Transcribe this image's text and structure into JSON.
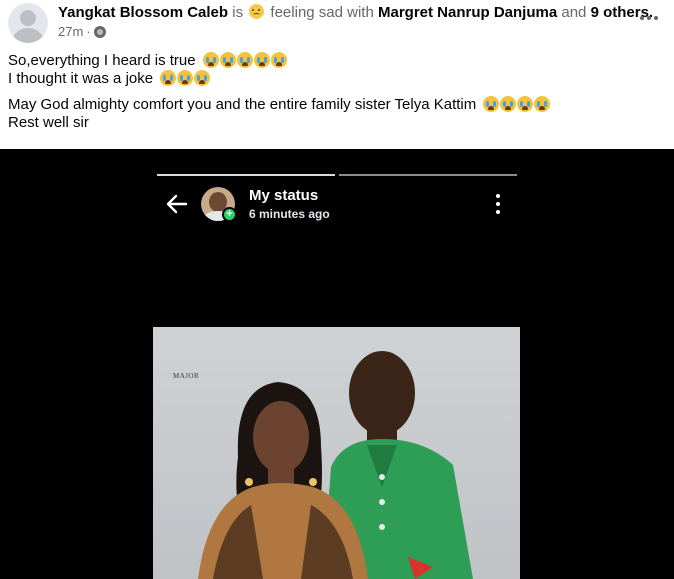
{
  "post": {
    "author": "Yangkat Blossom Caleb",
    "is_text": "is",
    "feeling_text": "feeling sad with",
    "tagged_person": "Margret Nanrup Danjuma",
    "and_text": "and",
    "others": "9 others.",
    "time": "27m",
    "privacy_icon": "globe-icon",
    "lines": [
      "So,everything I heard is true",
      "I thought it was a joke",
      "May God almighty comfort you and the entire family sister Telya Kattim",
      "Rest well sir"
    ],
    "emoji_counts": [
      5,
      3,
      4,
      0
    ]
  },
  "status": {
    "title": "My status",
    "time": "6 minutes ago",
    "progress_segments": 2,
    "active_segment": 1
  },
  "photo": {
    "logo_text": "MAJOR"
  },
  "colors": {
    "text_primary": "#050505",
    "text_secondary": "#65676b",
    "status_green": "#25d366",
    "media_background": "#000000"
  }
}
